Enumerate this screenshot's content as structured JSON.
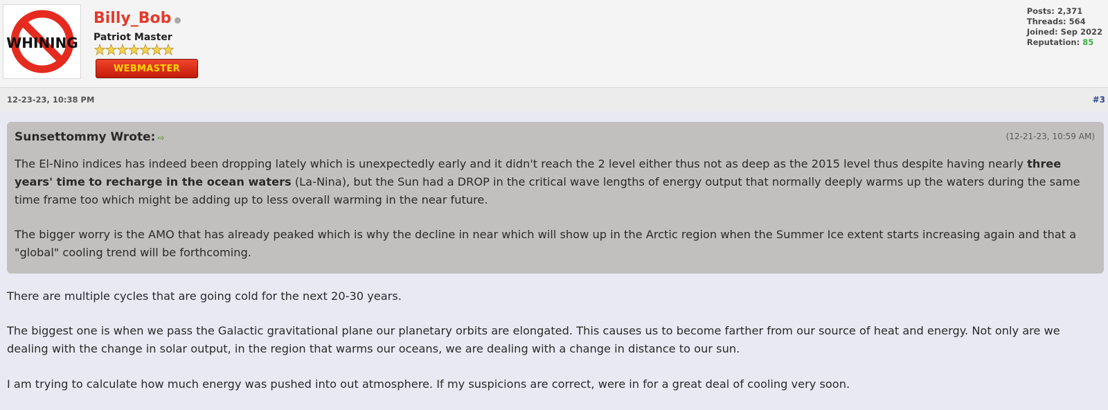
{
  "author": {
    "username": "Billy_Bob",
    "title": "Patriot Master",
    "badge": "WEBMASTER",
    "avatar_text": "WHINING",
    "status": "offline"
  },
  "stats": {
    "posts_label": "Posts: 2,371",
    "threads_label": "Threads: 564",
    "joined_label": "Joined: Sep 2022",
    "reputation_label": "Reputation: ",
    "reputation_value": "85"
  },
  "post": {
    "date": "12-23-23, 10:38 PM",
    "number": "#3"
  },
  "quote": {
    "author": "Sunsettommy Wrote:",
    "time": "(12-21-23, 10:59 AM)",
    "p1_before": "The El-Nino indices has indeed been dropping lately which is unexpectedly early and it didn't reach the 2 level either thus not as deep as the 2015 level thus despite having nearly ",
    "p1_bold": "three years' time to recharge in the ocean waters",
    "p1_after": " (La-Nina), but the Sun had a DROP in the critical wave lengths of energy output that normally deeply warms up the waters during the same time frame too which might be adding up to less overall warming in the near future.",
    "p2": "The bigger worry is the AMO that has already peaked which is why the decline in near which will show up in the Arctic region when the Summer Ice extent starts increasing again and that a \"global\" cooling trend will be forthcoming."
  },
  "body": {
    "p1": "There are multiple cycles that are going cold for the next 20-30 years.",
    "p2": "The biggest one is when we pass the Galactic gravitational plane our planetary orbits are elongated. This causes us to become farther from our source of heat and energy. Not only are we dealing with the change in solar output, in the region that warms our oceans, we are dealing with a change in distance to our sun.",
    "p3": "I am trying to calculate how much energy was pushed into out atmosphere. If my suspicions are correct, were in for a great deal of cooling very soon."
  },
  "colors": {
    "username": "#e53a2b",
    "badge_bg": "#d9261a",
    "badge_text": "#ffd700",
    "reputation": "#3cb043",
    "quote_bg": "#c2c0bf"
  },
  "rank_stars": 7
}
